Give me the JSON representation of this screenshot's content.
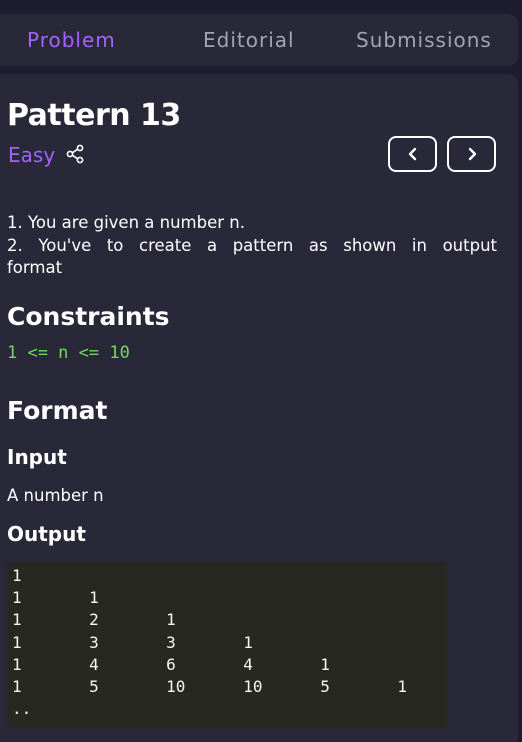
{
  "tabs": {
    "problem": "Problem",
    "editorial": "Editorial",
    "submissions": "Submissions"
  },
  "problem": {
    "title": "Pattern 13",
    "difficulty": "Easy",
    "description": [
      "1. You are given a number n.",
      "2. You've to create a pattern as shown in output format"
    ]
  },
  "sections": {
    "constraints_heading": "Constraints",
    "constraints_value": "1 <= n <= 10",
    "format_heading": "Format",
    "input_heading": "Input",
    "input_text": "A number n",
    "output_heading": "Output"
  },
  "output_block": {
    "top_partial": ". .",
    "lines": [
      "1",
      "1       1",
      "1       2       1",
      "1       3       3       1",
      "1       4       6       4       1",
      "1       5       10      10      5       1",
      ".."
    ]
  },
  "icons": {
    "share": "share-icon",
    "prev": "chevron-left-icon",
    "next": "chevron-right-icon"
  },
  "colors": {
    "background": "#1e1d2f",
    "panel": "#282839",
    "accent": "#a164ff",
    "code_green": "#6ddc5a",
    "code_bg": "#272822"
  }
}
